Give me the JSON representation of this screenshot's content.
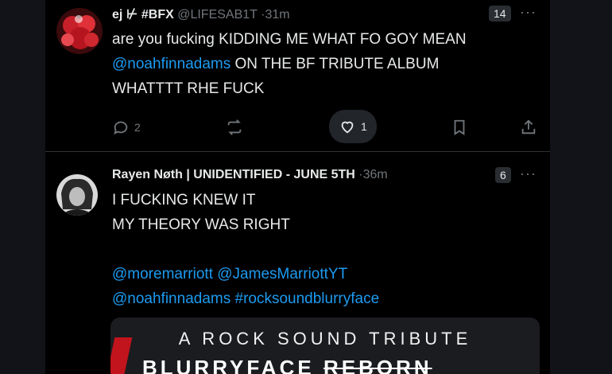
{
  "tweets": [
    {
      "name": "ej",
      "name_suffix": "⊬ #BFX",
      "handle": "@LIFESAB1T",
      "dot": "·",
      "time": "31m",
      "count_badge": "14",
      "more": "···",
      "lines": [
        {
          "text": "are you fucking KIDDING ME WHAT FO GOY MEAN"
        },
        {
          "link": "@noahfinnadams",
          "text": " ON THE BF TRIBUTE ALBUM"
        },
        {
          "text": "WHATTTT RHE FUCK"
        }
      ],
      "replies": "2",
      "reposts": "",
      "likes": "1"
    },
    {
      "name": "Rayen Nøth | UNIDENTIFIED - JUNE 5TH",
      "handle": "",
      "dot": "·",
      "time": "36m",
      "count_badge": "6",
      "more": "···",
      "lines": [
        {
          "text": "I FUCKING KNEW IT"
        },
        {
          "text": "MY THEORY WAS RIGHT"
        },
        {
          "text": ""
        },
        {
          "link1": "@moremarriott",
          "link2": "@JamesMarriottYT"
        },
        {
          "link1": "@noahfinnadams",
          "link2": "#rocksoundblurryface"
        }
      ],
      "card": {
        "line1": "A ROCK SOUND TRIBUTE",
        "line2a": "BLURRYFACE",
        "line2b": "REBORN"
      }
    }
  ],
  "colors": {
    "link": "#1d9bf0",
    "muted": "#71767b",
    "background": "#000000"
  },
  "icons": [
    "reply-icon",
    "repost-icon",
    "heart-icon",
    "bookmark-icon",
    "share-icon"
  ]
}
